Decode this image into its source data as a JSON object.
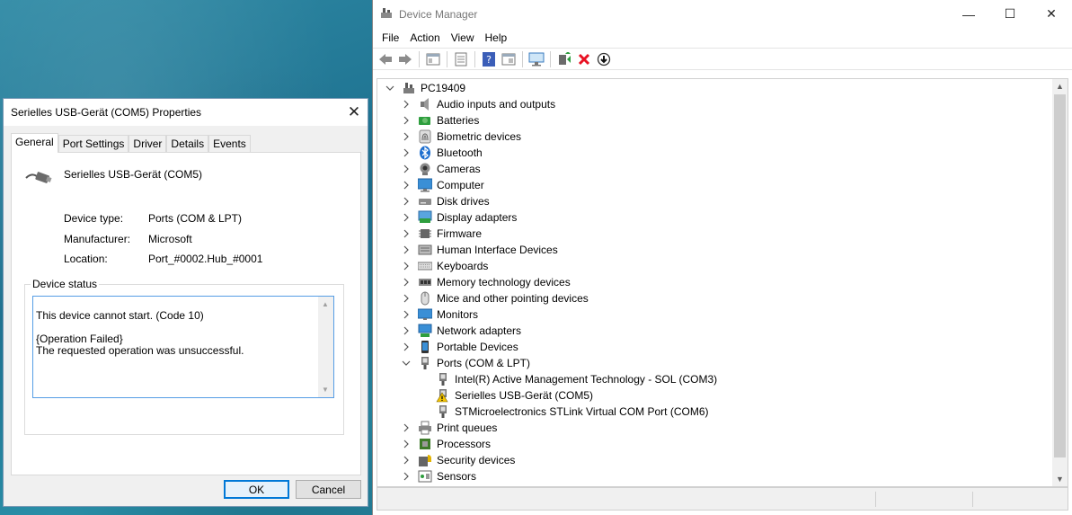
{
  "dialog": {
    "title": "Serielles USB-Gerät (COM5) Properties",
    "tabs": [
      "General",
      "Port Settings",
      "Driver",
      "Details",
      "Events"
    ],
    "device_name": "Serielles USB-Gerät (COM5)",
    "device_icon": "usb-cable-icon",
    "properties": [
      {
        "label": "Device type:",
        "value": "Ports (COM & LPT)"
      },
      {
        "label": "Manufacturer:",
        "value": "Microsoft"
      },
      {
        "label": "Location:",
        "value": "Port_#0002.Hub_#0001"
      }
    ],
    "status_label": "Device status",
    "status_text": "This device cannot start. (Code 10)\n\n{Operation Failed}\nThe requested operation was unsuccessful.",
    "ok_label": "OK",
    "cancel_label": "Cancel"
  },
  "device_manager": {
    "title": "Device Manager",
    "menu": [
      "File",
      "Action",
      "View",
      "Help"
    ],
    "toolbar_icons": [
      "back-icon",
      "forward-icon",
      "properties-view-icon",
      "update-driver-icon",
      "help-icon",
      "show-hidden-icon",
      "scan-hardware-icon",
      "add-driver-icon",
      "uninstall-icon",
      "disable-icon"
    ],
    "root": "PC19409",
    "categories": [
      {
        "label": "Audio inputs and outputs",
        "icon": "speaker-icon",
        "expanded": false
      },
      {
        "label": "Batteries",
        "icon": "battery-icon",
        "expanded": false
      },
      {
        "label": "Biometric devices",
        "icon": "fingerprint-icon",
        "expanded": false
      },
      {
        "label": "Bluetooth",
        "icon": "bluetooth-icon",
        "expanded": false
      },
      {
        "label": "Cameras",
        "icon": "camera-icon",
        "expanded": false
      },
      {
        "label": "Computer",
        "icon": "computer-icon",
        "expanded": false
      },
      {
        "label": "Disk drives",
        "icon": "disk-drive-icon",
        "expanded": false
      },
      {
        "label": "Display adapters",
        "icon": "display-adapter-icon",
        "expanded": false
      },
      {
        "label": "Firmware",
        "icon": "firmware-icon",
        "expanded": false
      },
      {
        "label": "Human Interface Devices",
        "icon": "hid-icon",
        "expanded": false
      },
      {
        "label": "Keyboards",
        "icon": "keyboard-icon",
        "expanded": false
      },
      {
        "label": "Memory technology devices",
        "icon": "memory-icon",
        "expanded": false
      },
      {
        "label": "Mice and other pointing devices",
        "icon": "mouse-icon",
        "expanded": false
      },
      {
        "label": "Monitors",
        "icon": "monitor-icon",
        "expanded": false
      },
      {
        "label": "Network adapters",
        "icon": "network-icon",
        "expanded": false
      },
      {
        "label": "Portable Devices",
        "icon": "portable-device-icon",
        "expanded": false
      },
      {
        "label": "Ports (COM & LPT)",
        "icon": "port-icon",
        "expanded": true,
        "children": [
          {
            "label": "Intel(R) Active Management Technology - SOL (COM3)",
            "icon": "port-icon",
            "warning": false
          },
          {
            "label": "Serielles USB-Gerät (COM5)",
            "icon": "port-warning-icon",
            "warning": true
          },
          {
            "label": "STMicroelectronics STLink Virtual COM Port (COM6)",
            "icon": "port-icon",
            "warning": false
          }
        ]
      },
      {
        "label": "Print queues",
        "icon": "printer-icon",
        "expanded": false
      },
      {
        "label": "Processors",
        "icon": "processor-icon",
        "expanded": false
      },
      {
        "label": "Security devices",
        "icon": "security-icon",
        "expanded": false
      },
      {
        "label": "Sensors",
        "icon": "sensor-icon",
        "expanded": false
      }
    ]
  },
  "colors": {
    "accent": "#0078d7",
    "focus_border": "#569de5",
    "warning": "#f4c400",
    "error": "#e81123"
  }
}
